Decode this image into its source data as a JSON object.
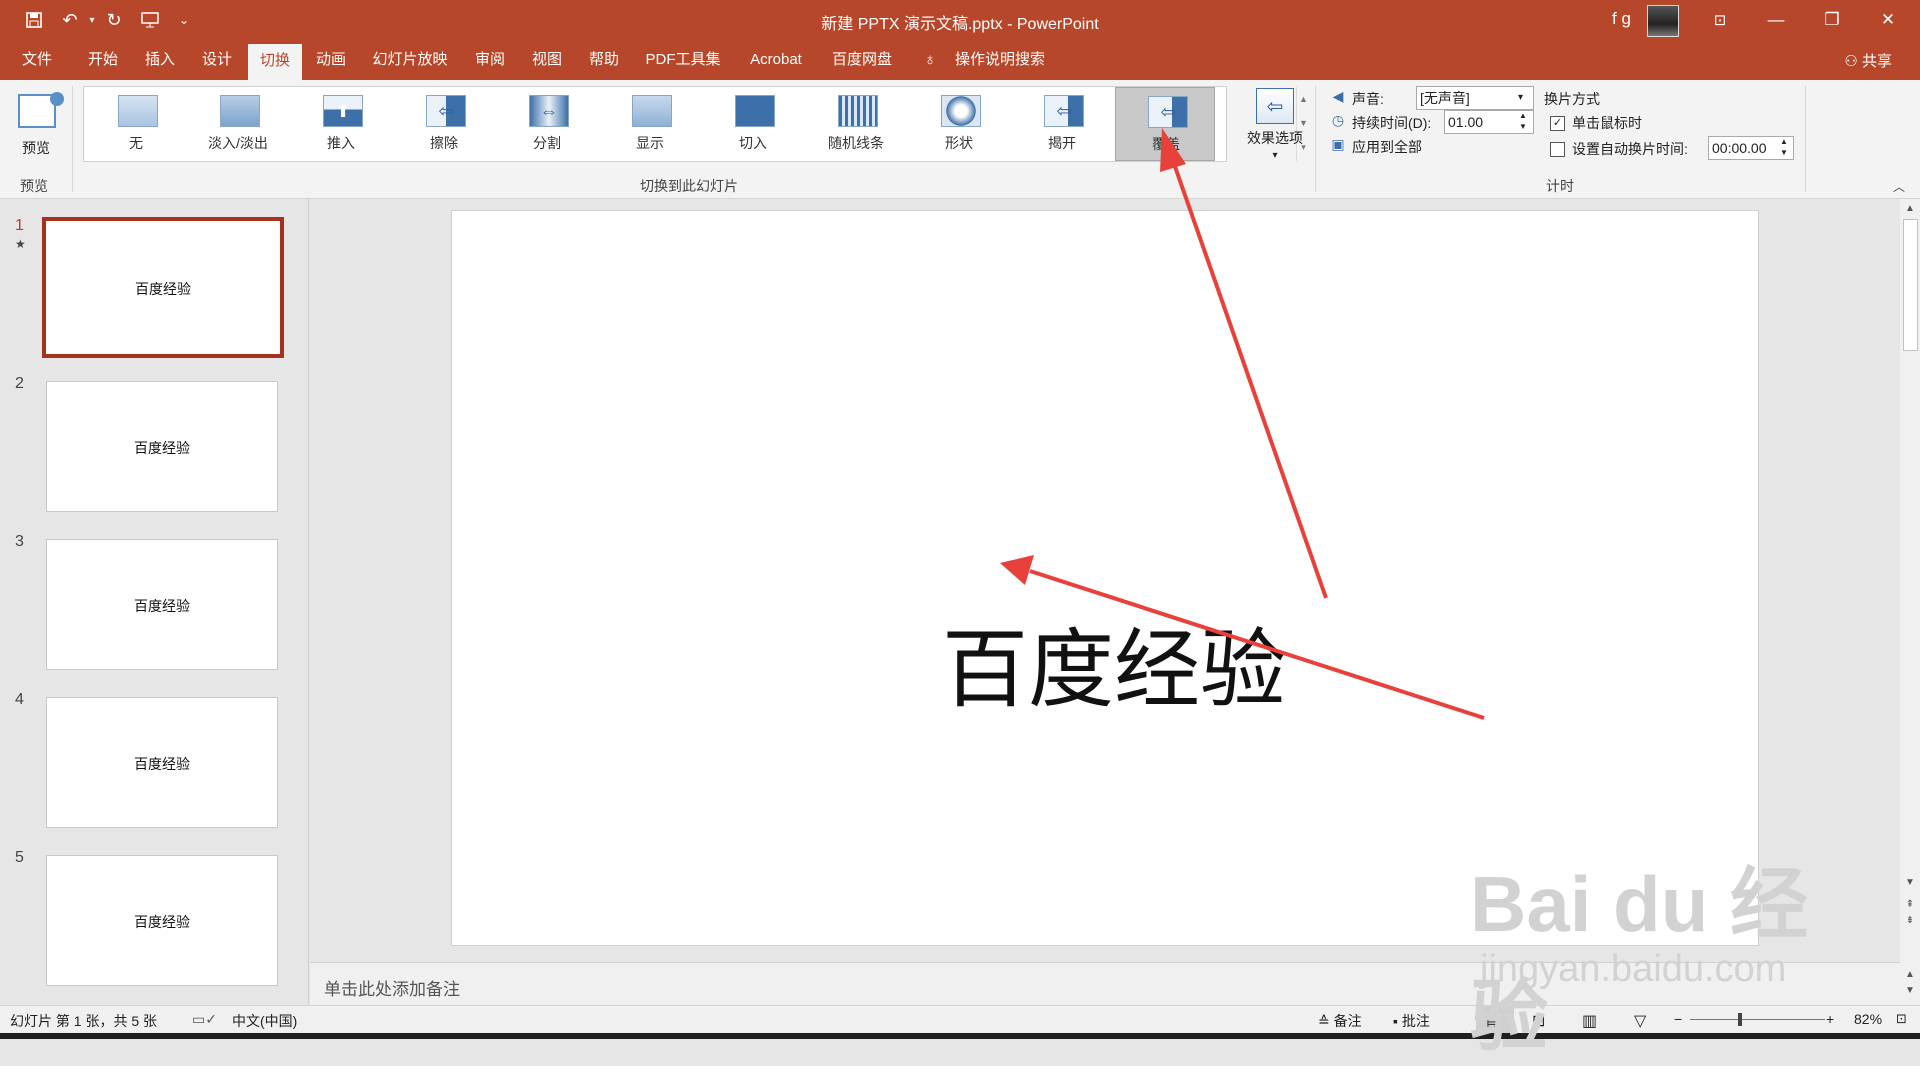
{
  "window": {
    "title": "新建 PPTX 演示文稿.pptx - PowerPoint",
    "user": "f g",
    "controls": {
      "ribbon_display": "⊡",
      "minimize": "—",
      "restore": "❐",
      "close": "✕"
    }
  },
  "quick_access": {
    "save_icon": "save-icon",
    "undo_icon": "undo-icon",
    "redo_icon": "repeat-icon",
    "present_icon": "present-icon",
    "customize": "⌄"
  },
  "menu": {
    "tabs": [
      {
        "label": "文件"
      },
      {
        "label": "开始"
      },
      {
        "label": "插入"
      },
      {
        "label": "设计"
      },
      {
        "label": "切换",
        "active": true
      },
      {
        "label": "动画"
      },
      {
        "label": "幻灯片放映"
      },
      {
        "label": "审阅"
      },
      {
        "label": "视图"
      },
      {
        "label": "帮助"
      },
      {
        "label": "PDF工具集"
      },
      {
        "label": "Acrobat"
      },
      {
        "label": "百度网盘"
      },
      {
        "label": "操作说明搜索"
      }
    ],
    "share": "共享"
  },
  "ribbon": {
    "preview": {
      "button": "预览",
      "group": "预览"
    },
    "transitions": {
      "group": "切换到此幻灯片",
      "items": [
        {
          "label": "无",
          "glyph": ""
        },
        {
          "label": "淡入/淡出",
          "glyph": ""
        },
        {
          "label": "推入",
          "glyph": "⬆"
        },
        {
          "label": "擦除",
          "glyph": "⇦"
        },
        {
          "label": "分割",
          "glyph": "⇔"
        },
        {
          "label": "显示",
          "glyph": ""
        },
        {
          "label": "切入",
          "glyph": ""
        },
        {
          "label": "随机线条",
          "glyph": "▥"
        },
        {
          "label": "形状",
          "glyph": "●"
        },
        {
          "label": "揭开",
          "glyph": "⇦"
        },
        {
          "label": "覆盖",
          "glyph": "⇦",
          "selected": true
        }
      ]
    },
    "effect_options": "效果选项",
    "timing": {
      "group": "计时",
      "sound_label": "声音:",
      "sound_value": "[无声音]",
      "duration_label": "持续时间(D):",
      "duration_value": "01.00",
      "apply_all": "应用到全部",
      "advance_title": "换片方式",
      "on_click_label": "单击鼠标时",
      "on_click_checked": true,
      "auto_label": "设置自动换片时间:",
      "auto_checked": false,
      "auto_value": "00:00.00"
    }
  },
  "thumbnails": [
    {
      "num": "1",
      "text": "百度经验",
      "selected": true,
      "star": "★"
    },
    {
      "num": "2",
      "text": "百度经验"
    },
    {
      "num": "3",
      "text": "百度经验"
    },
    {
      "num": "4",
      "text": "百度经验"
    },
    {
      "num": "5",
      "text": "百度经验"
    }
  ],
  "slide": {
    "text": "百度经验"
  },
  "notes_placeholder": "单击此处添加备注",
  "status": {
    "slide_info": "幻灯片 第 1 张，共 5 张",
    "language": "中文(中国)",
    "notes": "备注",
    "comments": "批注",
    "zoom": "82%"
  },
  "watermark": {
    "logo": "Bai du 经验",
    "url": "jingyan.baidu.com"
  },
  "colors": {
    "accent": "#b7472a",
    "selected_thumb_border": "#a3321f",
    "annotation_arrow": "#e8413c"
  }
}
